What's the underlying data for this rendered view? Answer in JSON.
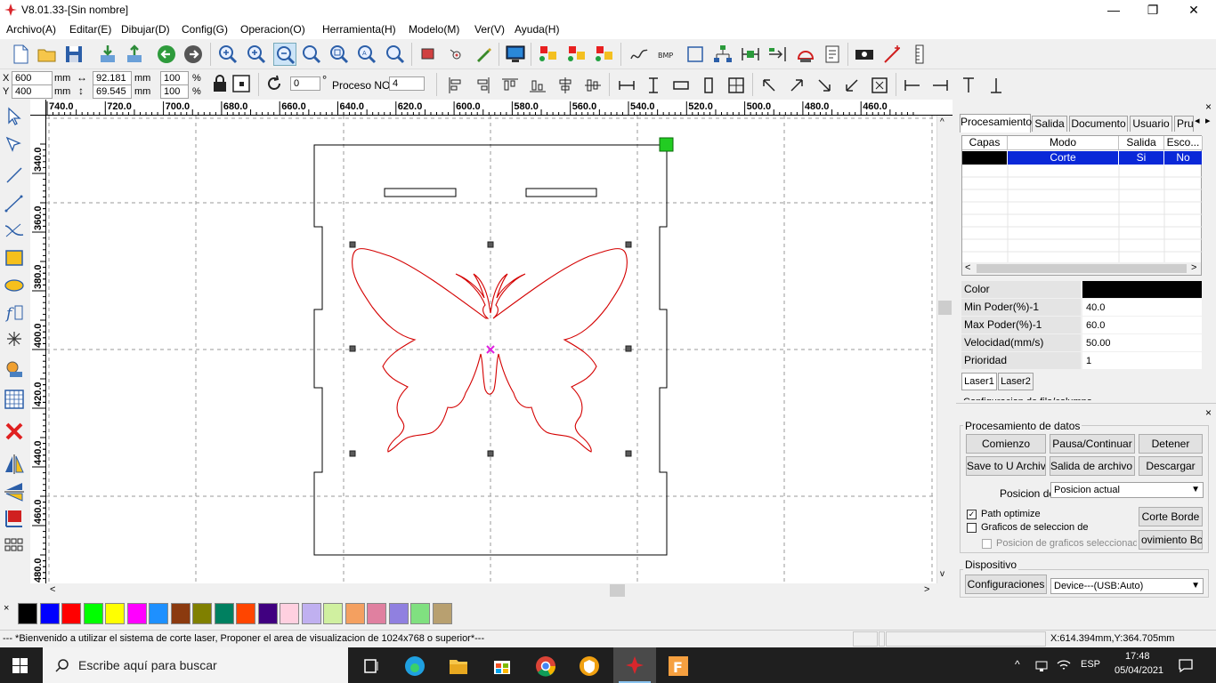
{
  "window": {
    "title": "V8.01.33-[Sin nombre]",
    "minimize": "—",
    "maximize": "❐",
    "close": "✕"
  },
  "menu": [
    "Archivo(A)",
    "Editar(E)",
    "Dibujar(D)",
    "Config(G)",
    "Operacion(O)",
    "Herramienta(H)",
    "Modelo(M)",
    "Ver(V)",
    "Ayuda(H)"
  ],
  "position": {
    "x_label": "X",
    "y_label": "Y",
    "x": "600",
    "y": "400",
    "unit": "mm",
    "width": "92.181",
    "height": "69.545",
    "scale_x": "100",
    "scale_y": "100",
    "percent": "%",
    "rotation": "0",
    "degree": "°",
    "process_label": "Proceso NO:",
    "process_no": "4"
  },
  "ruler": {
    "h_ticks": [
      "740.0",
      "720.0",
      "700.0",
      "680.0",
      "660.0",
      "640.0",
      "620.0",
      "600.0",
      "580.0",
      "560.0",
      "540.0",
      "520.0",
      "500.0",
      "480.0",
      "460.0"
    ],
    "v_ticks": [
      "340.0",
      "360.0",
      "380.0",
      "400.0",
      "420.0",
      "440.0",
      "460.0",
      "480.0"
    ]
  },
  "panel": {
    "tabs": [
      "Procesamiento",
      "Salida",
      "Documento",
      "Usuario",
      "Pru"
    ],
    "layer_headers": [
      "Capas",
      "Modo",
      "Salida",
      "Esco..."
    ],
    "layer_row": {
      "color": "#000000",
      "mode": "Corte",
      "output": "Si",
      "select": "No"
    },
    "properties": [
      {
        "name": "Color",
        "value": ""
      },
      {
        "name": "Min Poder(%)-1",
        "value": "40.0"
      },
      {
        "name": "Max Poder(%)-1",
        "value": "60.0"
      },
      {
        "name": "Velocidad(mm/s)",
        "value": "50.00"
      },
      {
        "name": "Prioridad",
        "value": "1"
      }
    ],
    "laser_tabs": [
      "Laser1",
      "Laser2"
    ],
    "config_partial": "Configuracion de fila/columna"
  },
  "processing": {
    "title": "Procesamiento de datos",
    "start": "Comienzo",
    "pause": "Pausa/Continuar",
    "stop": "Detener",
    "save_u": "Save to U Archivo",
    "output_u": "Salida de archivo U",
    "download": "Descargar",
    "position_label": "Posicion de",
    "position_value": "Posicion actual",
    "path_optimize": "Path optimize",
    "graphics_selection": "Graficos de seleccion de",
    "graphics_position": "Posicion de graficos seleccionado",
    "cut_border": "Corte Borde",
    "move_border": "ovimiento Bord"
  },
  "device": {
    "title": "Dispositivo",
    "config": "Configuraciones",
    "value": "Device---(USB:Auto)"
  },
  "palette": [
    "#000000",
    "#0000ff",
    "#ff0000",
    "#00ff00",
    "#ffff00",
    "#ff00ff",
    "#1e90ff",
    "#8b3a0f",
    "#808000",
    "#008060",
    "#ff4500",
    "#400080",
    "#ffd0e0",
    "#c0b0f0",
    "#d0f0a0",
    "#f4a060",
    "#e080a0",
    "#9080e0",
    "#80e080",
    "#b8a070"
  ],
  "status": {
    "message": "--- *Bienvenido a utilizar el sistema de corte laser, Proponer el area de visualizacion de 1024x768 o superior*---",
    "coords": "X:614.394mm,Y:364.705mm"
  },
  "taskbar": {
    "search": "Escribe aquí para buscar",
    "lang": "ESP",
    "time": "17:48",
    "date": "05/04/2021"
  }
}
